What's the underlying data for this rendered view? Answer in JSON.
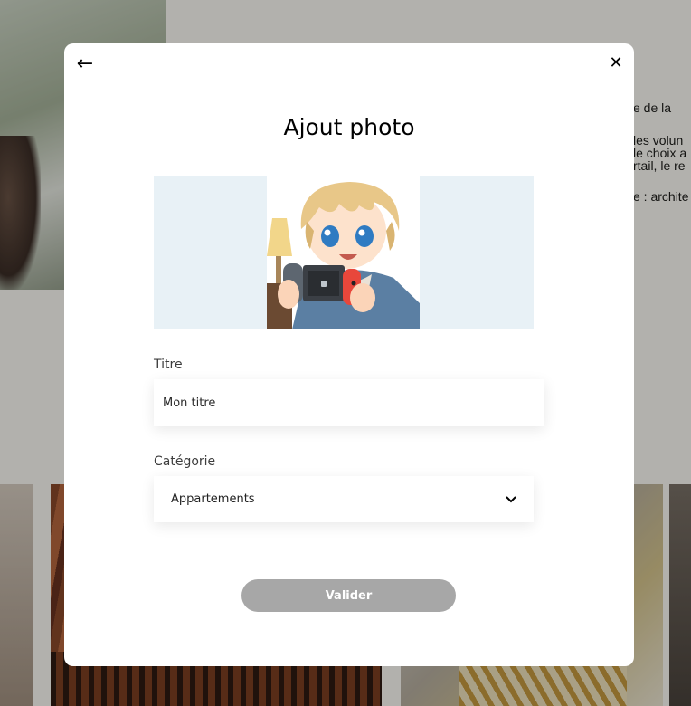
{
  "background_page": {
    "text_lines": [
      "e de la",
      "les volun",
      "le choix a",
      "rtail, le re",
      "e : archite"
    ]
  },
  "modal": {
    "back_icon": "arrow-left-icon",
    "close_icon": "close-icon",
    "title": "Ajout photo",
    "preview_image": "anime-boy-holding-game-console-image",
    "fields": {
      "title_label": "Titre",
      "title_value": "Mon titre",
      "category_label": "Catégorie",
      "category_selected": "Appartements"
    },
    "submit_label": "Valider"
  },
  "colors": {
    "preview_bg": "#e8f1f6",
    "submit_disabled": "#a7a7a7",
    "overlay": "rgba(0,0,0,0.3)"
  }
}
